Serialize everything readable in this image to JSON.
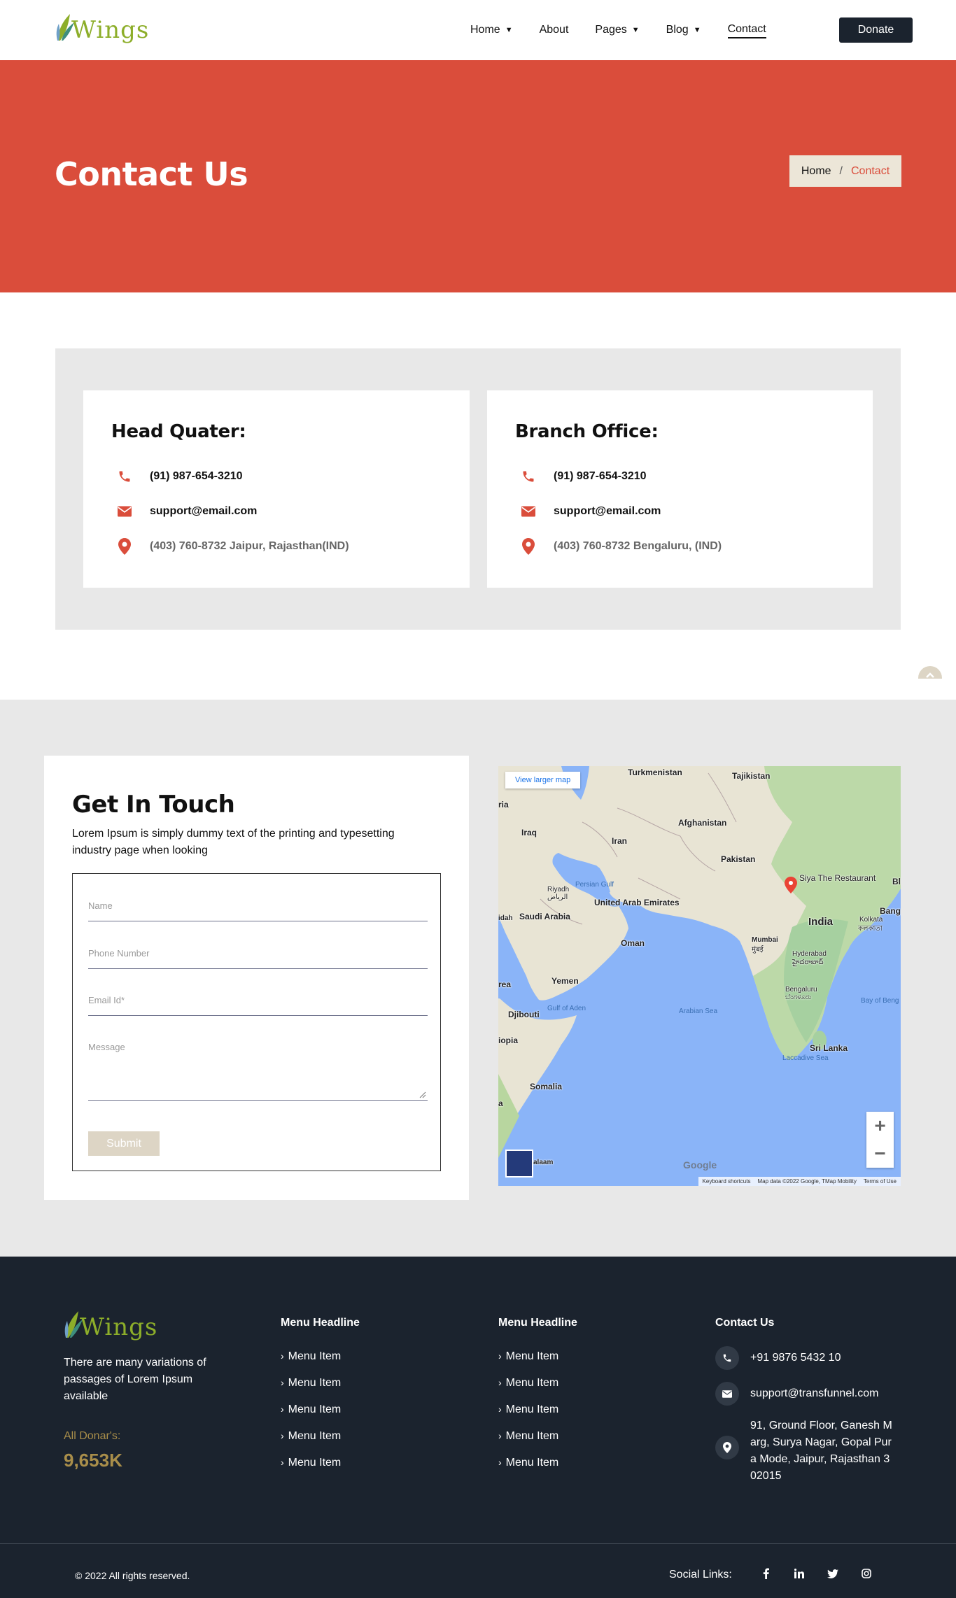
{
  "brand": {
    "name": "Wings",
    "brand_color": "#8dae2a"
  },
  "nav": {
    "items": [
      {
        "label": "Home",
        "dropdown": true
      },
      {
        "label": "About",
        "dropdown": false
      },
      {
        "label": "Pages",
        "dropdown": true
      },
      {
        "label": "Blog",
        "dropdown": true
      },
      {
        "label": "Contact",
        "dropdown": false,
        "active": true
      }
    ],
    "donate_label": "Donate"
  },
  "banner": {
    "title": "Contact Us",
    "breadcrumb": {
      "home": "Home",
      "separator": "/",
      "current": "Contact"
    },
    "color": "#da4d3b"
  },
  "offices": [
    {
      "title": "Head Quater:",
      "phone": "(91) 987-654-3210",
      "email": "support@email.com",
      "address": "(403) 760-8732 Jaipur, Rajasthan(IND)"
    },
    {
      "title": "Branch Office:",
      "phone": "(91) 987-654-3210",
      "email": "support@email.com",
      "address": "(403) 760-8732 Bengaluru, (IND)"
    }
  ],
  "contact_form": {
    "title": "Get In Touch",
    "intro": "Lorem Ipsum is simply dummy text of the printing and typesetting industry page when looking",
    "fields": {
      "name_placeholder": "Name",
      "phone_placeholder": "Phone Number",
      "email_placeholder": "Email Id*",
      "message_placeholder": "Message"
    },
    "submit_label": "Submit"
  },
  "map": {
    "view_larger_label": "View larger map",
    "labels": {
      "turkmenistan": "Turkmenistan",
      "tajikistan": "Tajikistan",
      "afghanistan": "Afghanistan",
      "iraq": "Iraq",
      "iran": "Iran",
      "pakistan": "Pakistan",
      "restaurant": "Siya The Restaurant",
      "riyadh": "Riyadh",
      "riyadh_ar": "الرياض",
      "uae": "United Arab Emirates",
      "saudi": "Saudi Arabia",
      "oman": "Oman",
      "india": "India",
      "mumbai": "Mumbai",
      "mumbai_local": "मुंबई",
      "hyderabad": "Hyderabad",
      "hyderabad_local": "హైదరాబాద్",
      "kolkata": "Kolkata",
      "kolkata_local": "কলকাতা",
      "bengaluru": "Bengaluru",
      "bengaluru_local": "ಬೆಂಗಳೂರು",
      "yemen": "Yemen",
      "djibouti": "Djibouti",
      "sri_lanka": "Sri Lanka",
      "somalia": "Somalia",
      "persian_gulf": "Persian Gulf",
      "gulf_aden": "Gulf of Aden",
      "arabian_sea": "Arabian Sea",
      "laccadive": "Laccadive Sea",
      "bay_bengal": "Bay of Beng",
      "edge_ria": "ria",
      "edge_idah": "idah",
      "edge_rea": "rea",
      "edge_iopia": "iopia",
      "edge_a": "a",
      "edge_bang": "Bang",
      "edge_bl": "Bl",
      "dar": "alaam"
    },
    "attribution": {
      "shortcuts": "Keyboard shortcuts",
      "data": "Map data ©2022 Google, TMap Mobility",
      "terms": "Terms of Use"
    },
    "google": "Google",
    "zoom_in": "+",
    "zoom_out": "−"
  },
  "footer": {
    "about": "There are many variations of passages of Lorem Ipsum available",
    "donar_label": "All Donar's:",
    "donar_value": "9,653K",
    "menu1": {
      "headline": "Menu Headline",
      "items": [
        "Menu Item",
        "Menu Item",
        "Menu Item",
        "Menu Item",
        "Menu Item"
      ]
    },
    "menu2": {
      "headline": "Menu Headline",
      "items": [
        "Menu Item",
        "Menu Item",
        "Menu Item",
        "Menu Item",
        "Menu Item"
      ]
    },
    "contact": {
      "headline": "Contact Us",
      "phone": "+91 9876 5432 10",
      "email": "support@transfunnel.com",
      "address": "91, Ground Floor, Ganesh Marg, Surya Nagar, Gopal Pura Mode, Jaipur, Rajasthan 302015"
    },
    "copyright": "© 2022 All rights reserved.",
    "social_label": "Social Links:",
    "social": [
      {
        "icon": "facebook-icon",
        "glyph": "f"
      },
      {
        "icon": "linkedin-icon",
        "glyph": "in"
      },
      {
        "icon": "twitter-icon",
        "glyph": "t"
      },
      {
        "icon": "instagram-icon",
        "glyph": "ig"
      }
    ]
  },
  "colors": {
    "dark": "#1b232e",
    "accent": "#da4d3b",
    "gold": "#a98e4a",
    "beige": "#ddd5c5"
  }
}
